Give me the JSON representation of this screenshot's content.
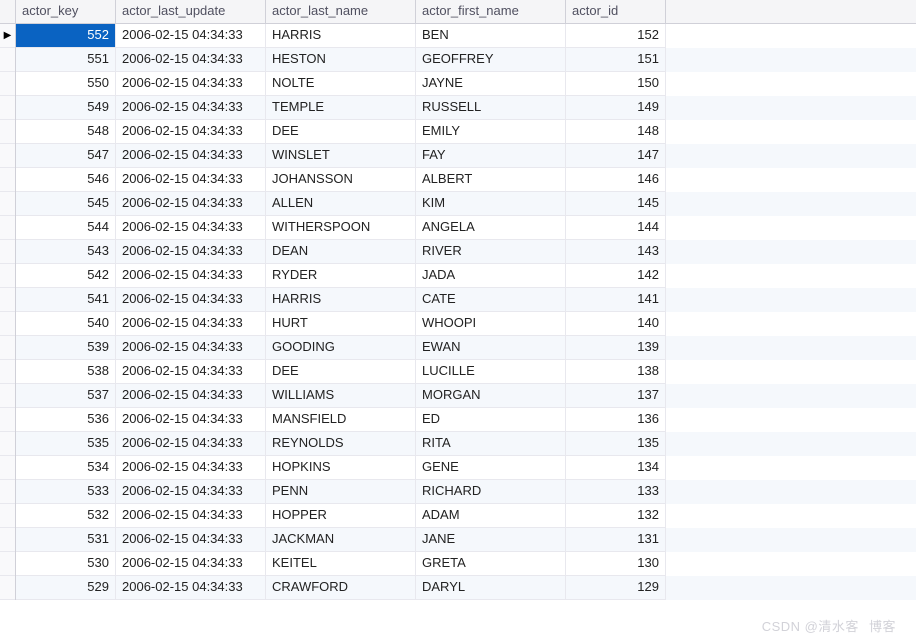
{
  "columns": {
    "actor_key": "actor_key",
    "actor_last_update": "actor_last_update",
    "actor_last_name": "actor_last_name",
    "actor_first_name": "actor_first_name",
    "actor_id": "actor_id"
  },
  "active_row_marker": "▶",
  "watermark_left": "CSDN @清水客",
  "watermark_right": "博客",
  "rows": [
    {
      "actor_key": "552",
      "actor_last_update": "2006-02-15 04:34:33",
      "actor_last_name": "HARRIS",
      "actor_first_name": "BEN",
      "actor_id": "152",
      "selected": true
    },
    {
      "actor_key": "551",
      "actor_last_update": "2006-02-15 04:34:33",
      "actor_last_name": "HESTON",
      "actor_first_name": "GEOFFREY",
      "actor_id": "151"
    },
    {
      "actor_key": "550",
      "actor_last_update": "2006-02-15 04:34:33",
      "actor_last_name": "NOLTE",
      "actor_first_name": "JAYNE",
      "actor_id": "150"
    },
    {
      "actor_key": "549",
      "actor_last_update": "2006-02-15 04:34:33",
      "actor_last_name": "TEMPLE",
      "actor_first_name": "RUSSELL",
      "actor_id": "149"
    },
    {
      "actor_key": "548",
      "actor_last_update": "2006-02-15 04:34:33",
      "actor_last_name": "DEE",
      "actor_first_name": "EMILY",
      "actor_id": "148"
    },
    {
      "actor_key": "547",
      "actor_last_update": "2006-02-15 04:34:33",
      "actor_last_name": "WINSLET",
      "actor_first_name": "FAY",
      "actor_id": "147"
    },
    {
      "actor_key": "546",
      "actor_last_update": "2006-02-15 04:34:33",
      "actor_last_name": "JOHANSSON",
      "actor_first_name": "ALBERT",
      "actor_id": "146"
    },
    {
      "actor_key": "545",
      "actor_last_update": "2006-02-15 04:34:33",
      "actor_last_name": "ALLEN",
      "actor_first_name": "KIM",
      "actor_id": "145"
    },
    {
      "actor_key": "544",
      "actor_last_update": "2006-02-15 04:34:33",
      "actor_last_name": "WITHERSPOON",
      "actor_first_name": "ANGELA",
      "actor_id": "144"
    },
    {
      "actor_key": "543",
      "actor_last_update": "2006-02-15 04:34:33",
      "actor_last_name": "DEAN",
      "actor_first_name": "RIVER",
      "actor_id": "143"
    },
    {
      "actor_key": "542",
      "actor_last_update": "2006-02-15 04:34:33",
      "actor_last_name": "RYDER",
      "actor_first_name": "JADA",
      "actor_id": "142"
    },
    {
      "actor_key": "541",
      "actor_last_update": "2006-02-15 04:34:33",
      "actor_last_name": "HARRIS",
      "actor_first_name": "CATE",
      "actor_id": "141"
    },
    {
      "actor_key": "540",
      "actor_last_update": "2006-02-15 04:34:33",
      "actor_last_name": "HURT",
      "actor_first_name": "WHOOPI",
      "actor_id": "140"
    },
    {
      "actor_key": "539",
      "actor_last_update": "2006-02-15 04:34:33",
      "actor_last_name": "GOODING",
      "actor_first_name": "EWAN",
      "actor_id": "139"
    },
    {
      "actor_key": "538",
      "actor_last_update": "2006-02-15 04:34:33",
      "actor_last_name": "DEE",
      "actor_first_name": "LUCILLE",
      "actor_id": "138"
    },
    {
      "actor_key": "537",
      "actor_last_update": "2006-02-15 04:34:33",
      "actor_last_name": "WILLIAMS",
      "actor_first_name": "MORGAN",
      "actor_id": "137"
    },
    {
      "actor_key": "536",
      "actor_last_update": "2006-02-15 04:34:33",
      "actor_last_name": "MANSFIELD",
      "actor_first_name": "ED",
      "actor_id": "136"
    },
    {
      "actor_key": "535",
      "actor_last_update": "2006-02-15 04:34:33",
      "actor_last_name": "REYNOLDS",
      "actor_first_name": "RITA",
      "actor_id": "135"
    },
    {
      "actor_key": "534",
      "actor_last_update": "2006-02-15 04:34:33",
      "actor_last_name": "HOPKINS",
      "actor_first_name": "GENE",
      "actor_id": "134"
    },
    {
      "actor_key": "533",
      "actor_last_update": "2006-02-15 04:34:33",
      "actor_last_name": "PENN",
      "actor_first_name": "RICHARD",
      "actor_id": "133"
    },
    {
      "actor_key": "532",
      "actor_last_update": "2006-02-15 04:34:33",
      "actor_last_name": "HOPPER",
      "actor_first_name": "ADAM",
      "actor_id": "132"
    },
    {
      "actor_key": "531",
      "actor_last_update": "2006-02-15 04:34:33",
      "actor_last_name": "JACKMAN",
      "actor_first_name": "JANE",
      "actor_id": "131"
    },
    {
      "actor_key": "530",
      "actor_last_update": "2006-02-15 04:34:33",
      "actor_last_name": "KEITEL",
      "actor_first_name": "GRETA",
      "actor_id": "130"
    },
    {
      "actor_key": "529",
      "actor_last_update": "2006-02-15 04:34:33",
      "actor_last_name": "CRAWFORD",
      "actor_first_name": "DARYL",
      "actor_id": "129"
    }
  ]
}
